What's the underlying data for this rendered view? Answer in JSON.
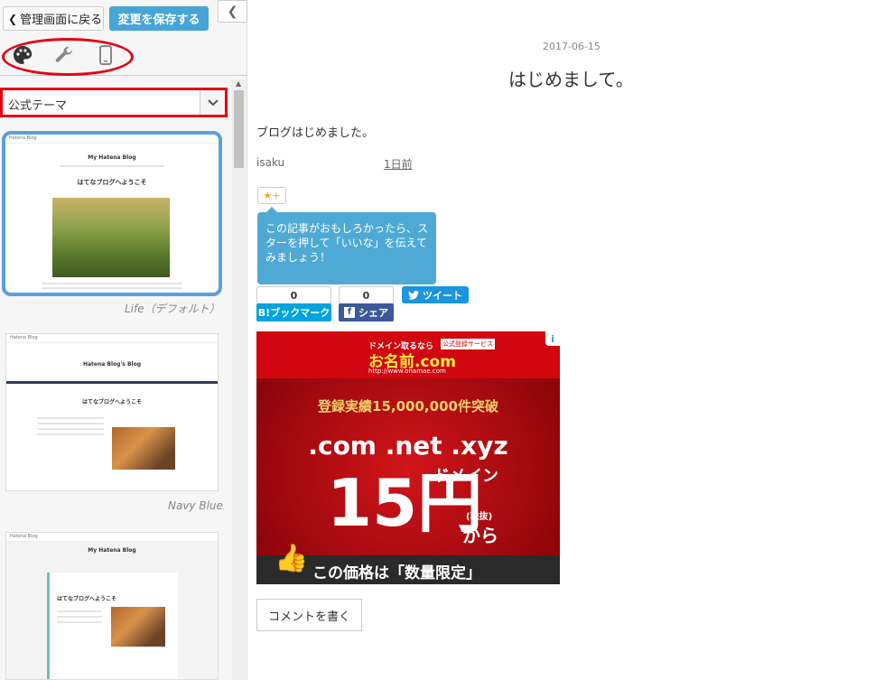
{
  "toolbar": {
    "back_label": "管理画面に戻る",
    "save_label": "変更を保存する"
  },
  "tabs": [
    {
      "name": "design",
      "icon": "palette-icon"
    },
    {
      "name": "customize",
      "icon": "wrench-icon"
    },
    {
      "name": "smartphone",
      "icon": "smartphone-icon"
    }
  ],
  "theme_select": {
    "selected": "公式テーマ"
  },
  "themes": [
    {
      "name": "Life（デフォルト）",
      "preview": {
        "site": "Hatena Blog",
        "blog_title": "My Hatena Blog",
        "heading": "はてなブログへようこそ"
      }
    },
    {
      "name": "Navy Blue",
      "preview": {
        "site": "Hatena Blog",
        "blog_title": "Hatena Blog's Blog",
        "heading": "はてなブログへようこそ"
      }
    },
    {
      "name": "",
      "preview": {
        "site": "Hatena Blog",
        "blog_title": "My Hatena Blog",
        "heading": "はてなブログへようこそ"
      }
    }
  ],
  "post": {
    "date": "2017-06-15",
    "title": "はじめまして。",
    "body": "ブログはじめました。",
    "author": "isaku",
    "time": "1日前"
  },
  "star": {
    "label": "★+"
  },
  "tooltip": {
    "text": "この記事がおもしろかったら、スターを押して「いいな」を伝えてみましょう！"
  },
  "share": {
    "hatena_count": "0",
    "hatena_label": "B!ブックマーク",
    "facebook_count": "0",
    "facebook_label": "シェア",
    "tweet_label": "ツイート"
  },
  "ad": {
    "top_text": "ドメイン取るなら",
    "badge": "公式登録サービス",
    "brand": "お名前.com",
    "url": "http://www.onamae.com",
    "record": "登録実績15,000,000件突破",
    "tlds": ".com .net .xyz",
    "domain_label": "ドメイン",
    "price": "15円",
    "tax": "(税抜)",
    "from": "から",
    "limited": "この価格は「数量限定」"
  },
  "comment": {
    "label": "コメントを書く"
  },
  "colors": {
    "save_button": "#46a5d6",
    "highlight_red": "#e60012",
    "selected_theme_border": "#5aa0df",
    "tooltip": "#4eaad4",
    "hatena": "#00a4de",
    "facebook": "#3b5998",
    "twitter": "#1b95e0"
  }
}
